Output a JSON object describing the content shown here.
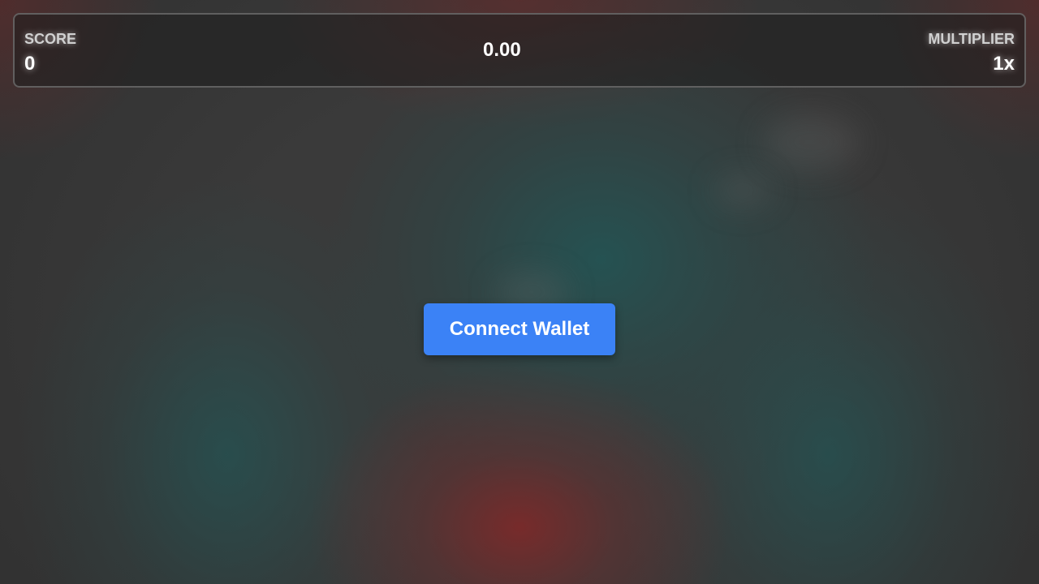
{
  "hud": {
    "score_label": "SCORE",
    "score_value": "0",
    "center_value": "0.00",
    "multiplier_label": "MULTIPLIER",
    "multiplier_value": "1x"
  },
  "main": {
    "connect_button_label": "Connect Wallet"
  },
  "colors": {
    "button_accent": "#3b82f6",
    "hud_text": "#ffffff",
    "hud_label": "#d0d0d0"
  }
}
